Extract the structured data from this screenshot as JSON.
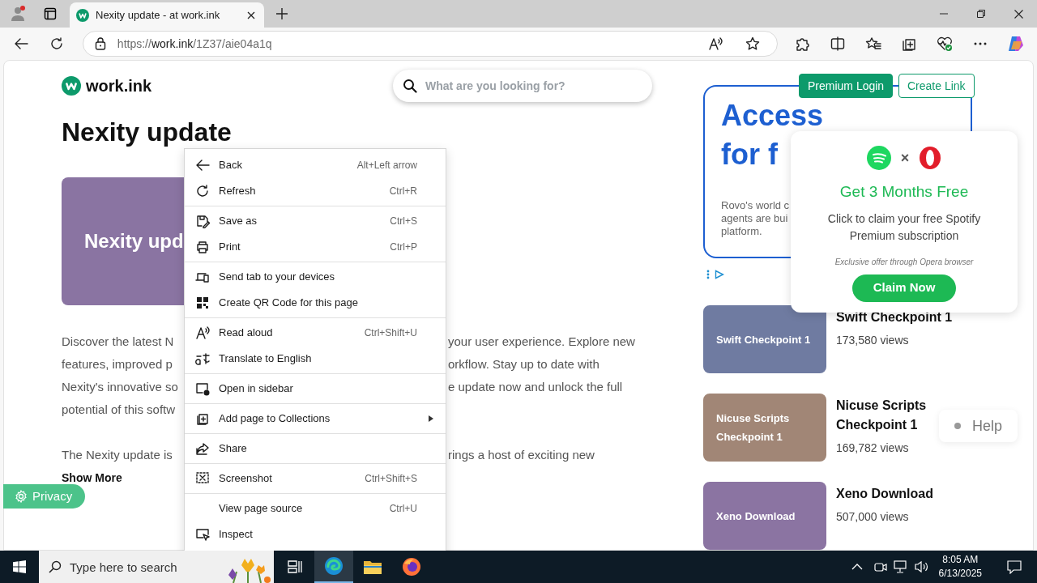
{
  "browser": {
    "tab": {
      "title": "Nexity update - at work.ink",
      "selected": true
    },
    "url": {
      "scheme": "https://",
      "host": "work.ink",
      "path": "/1Z37/aie04a1q"
    }
  },
  "page": {
    "logo": "work.ink",
    "search": {
      "placeholder": "What are you looking for?"
    },
    "title": "Nexity update",
    "hero_text": "Nexity upd",
    "paragraphs": [
      {
        "lines": [
          {
            "left": "Discover the latest N",
            "right": "your user experience. Explore new"
          },
          {
            "left": "features, improved p",
            "right": "orkflow. Stay up to date with"
          },
          {
            "left": "Nexity's innovative so",
            "right": "e update now and unlock the full"
          },
          {
            "left": "potential of this softw"
          }
        ]
      },
      {
        "lines": [
          {
            "left": "The Nexity update is",
            "right": "rings a host of exciting new"
          }
        ]
      }
    ],
    "show_more": "Show More"
  },
  "header_buttons": [
    {
      "label": "Premium Login",
      "kind": "filled"
    },
    {
      "label": "Create Link",
      "kind": "outline"
    }
  ],
  "ad": {
    "heading_lines": [
      "Access",
      "for f"
    ],
    "body_lines": [
      "Rovo's world c",
      "agents are bui",
      "platform."
    ]
  },
  "related": [
    {
      "thumb_text": "Swift Checkpoint 1",
      "title_lines": [
        "Swift Checkpoint 1"
      ],
      "views": "173,580 views",
      "color": "#6f7ba1"
    },
    {
      "thumb_text": "Nicuse Scripts Checkpoint 1",
      "title_lines": [
        "Nicuse Scripts",
        "Checkpoint 1"
      ],
      "views": "169,782 views",
      "color": "#a18676"
    },
    {
      "thumb_text": "Xeno Download",
      "title_lines": [
        "Xeno Download"
      ],
      "views": "507,000 views",
      "color": "#8b74a2"
    }
  ],
  "popup": {
    "separator": "×",
    "headline": "Get 3 Months Free",
    "body": "Click to claim your free Spotify Premium subscription",
    "note": "Exclusive offer through Opera browser",
    "button": "Claim Now"
  },
  "help": "Help",
  "privacy": "Privacy",
  "context_menu": {
    "groups": [
      [
        {
          "label": "Back",
          "shortcut": "Alt+Left arrow",
          "kind": "back",
          "submenu": false
        },
        {
          "label": "Refresh",
          "shortcut": "Ctrl+R",
          "kind": "refresh",
          "submenu": false
        }
      ],
      [
        {
          "label": "Save as",
          "shortcut": "Ctrl+S",
          "kind": "save",
          "submenu": false
        },
        {
          "label": "Print",
          "shortcut": "Ctrl+P",
          "kind": "print",
          "submenu": false
        }
      ],
      [
        {
          "label": "Send tab to your devices",
          "kind": "devices",
          "submenu": false
        },
        {
          "label": "Create QR Code for this page",
          "kind": "qr",
          "submenu": false
        }
      ],
      [
        {
          "label": "Read aloud",
          "shortcut": "Ctrl+Shift+U",
          "kind": "read",
          "submenu": false
        },
        {
          "label": "Translate to English",
          "kind": "translate",
          "submenu": false
        }
      ],
      [
        {
          "label": "Open in sidebar",
          "kind": "sidebar",
          "submenu": false
        }
      ],
      [
        {
          "label": "Add page to Collections",
          "kind": "collections",
          "submenu": true
        }
      ],
      [
        {
          "label": "Share",
          "kind": "share",
          "submenu": false
        }
      ],
      [
        {
          "label": "Screenshot",
          "shortcut": "Ctrl+Shift+S",
          "kind": "screenshot",
          "submenu": false
        }
      ],
      [
        {
          "label": "View page source",
          "shortcut": "Ctrl+U",
          "submenu": false
        },
        {
          "label": "Inspect",
          "kind": "inspect",
          "submenu": false
        }
      ]
    ]
  },
  "taskbar": {
    "search_placeholder": "Type here to search",
    "time": "8:05 AM",
    "date": "6/13/2025"
  }
}
